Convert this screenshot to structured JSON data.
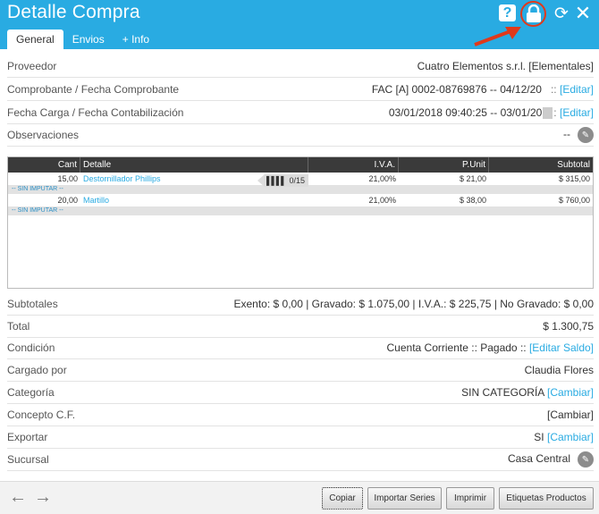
{
  "window": {
    "title": "Detalle Compra",
    "help_label": "?"
  },
  "tabs": [
    {
      "label": "General"
    },
    {
      "label": "Envios"
    },
    {
      "label": "+ Info"
    }
  ],
  "colors": {
    "accent": "#29abe2",
    "highlight": "#e0391b"
  },
  "fields": {
    "proveedor": {
      "label": "Proveedor",
      "value": "Cuatro Elementos s.r.l. [Elementales]"
    },
    "comprobante": {
      "label": "Comprobante / Fecha Comprobante",
      "value": "FAC [A] 0002-08769876 -- 04/12/20",
      "sep": "::",
      "action": "[Editar]"
    },
    "fecha_carga": {
      "label": "Fecha Carga / Fecha Contabilización",
      "value": "03/01/2018 09:40:25 -- 03/01/20",
      "sep": ":",
      "action": "[Editar]"
    },
    "observaciones": {
      "label": "Observaciones",
      "value": "--"
    }
  },
  "grid": {
    "headers": [
      "Cant",
      "Detalle",
      "I.V.A.",
      "P.Unit",
      "Subtotal"
    ],
    "rows": [
      {
        "cant": "15,00",
        "detalle": "Destornillador Phillips",
        "iva": "21,00%",
        "punit": "$ 21,00",
        "subtotal": "$ 315,00",
        "series": "0/15",
        "note": "-- SIN IMPUTAR --"
      },
      {
        "cant": "20,00",
        "detalle": "Martillo",
        "iva": "21,00%",
        "punit": "$ 38,00",
        "subtotal": "$ 760,00",
        "note": "-- SIN IMPUTAR --"
      }
    ]
  },
  "summary": {
    "subtotales": {
      "label": "Subtotales",
      "value": "Exento: $ 0,00 | Gravado: $ 1.075,00 | I.V.A.: $ 225,75 | No Gravado: $ 0,00"
    },
    "total": {
      "label": "Total",
      "value": "$ 1.300,75"
    },
    "condicion": {
      "label": "Condición",
      "value": "Cuenta Corriente :: Pagado ::",
      "action": "[Editar Saldo]"
    },
    "cargado_por": {
      "label": "Cargado por",
      "value": "Claudia Flores"
    },
    "categoria": {
      "label": "Categoría",
      "value": "SIN CATEGORÍA",
      "action": "[Cambiar]"
    },
    "concepto": {
      "label": "Concepto C.F.",
      "action": "[Cambiar]"
    },
    "exportar": {
      "label": "Exportar",
      "value": "SI",
      "action": "[Cambiar]"
    },
    "sucursal": {
      "label": "Sucursal",
      "value": "Casa Central"
    }
  },
  "footer": {
    "back": "←",
    "forward": "→",
    "buttons": [
      "Copiar",
      "Importar Series",
      "Imprimir",
      "Etiquetas Productos"
    ]
  }
}
